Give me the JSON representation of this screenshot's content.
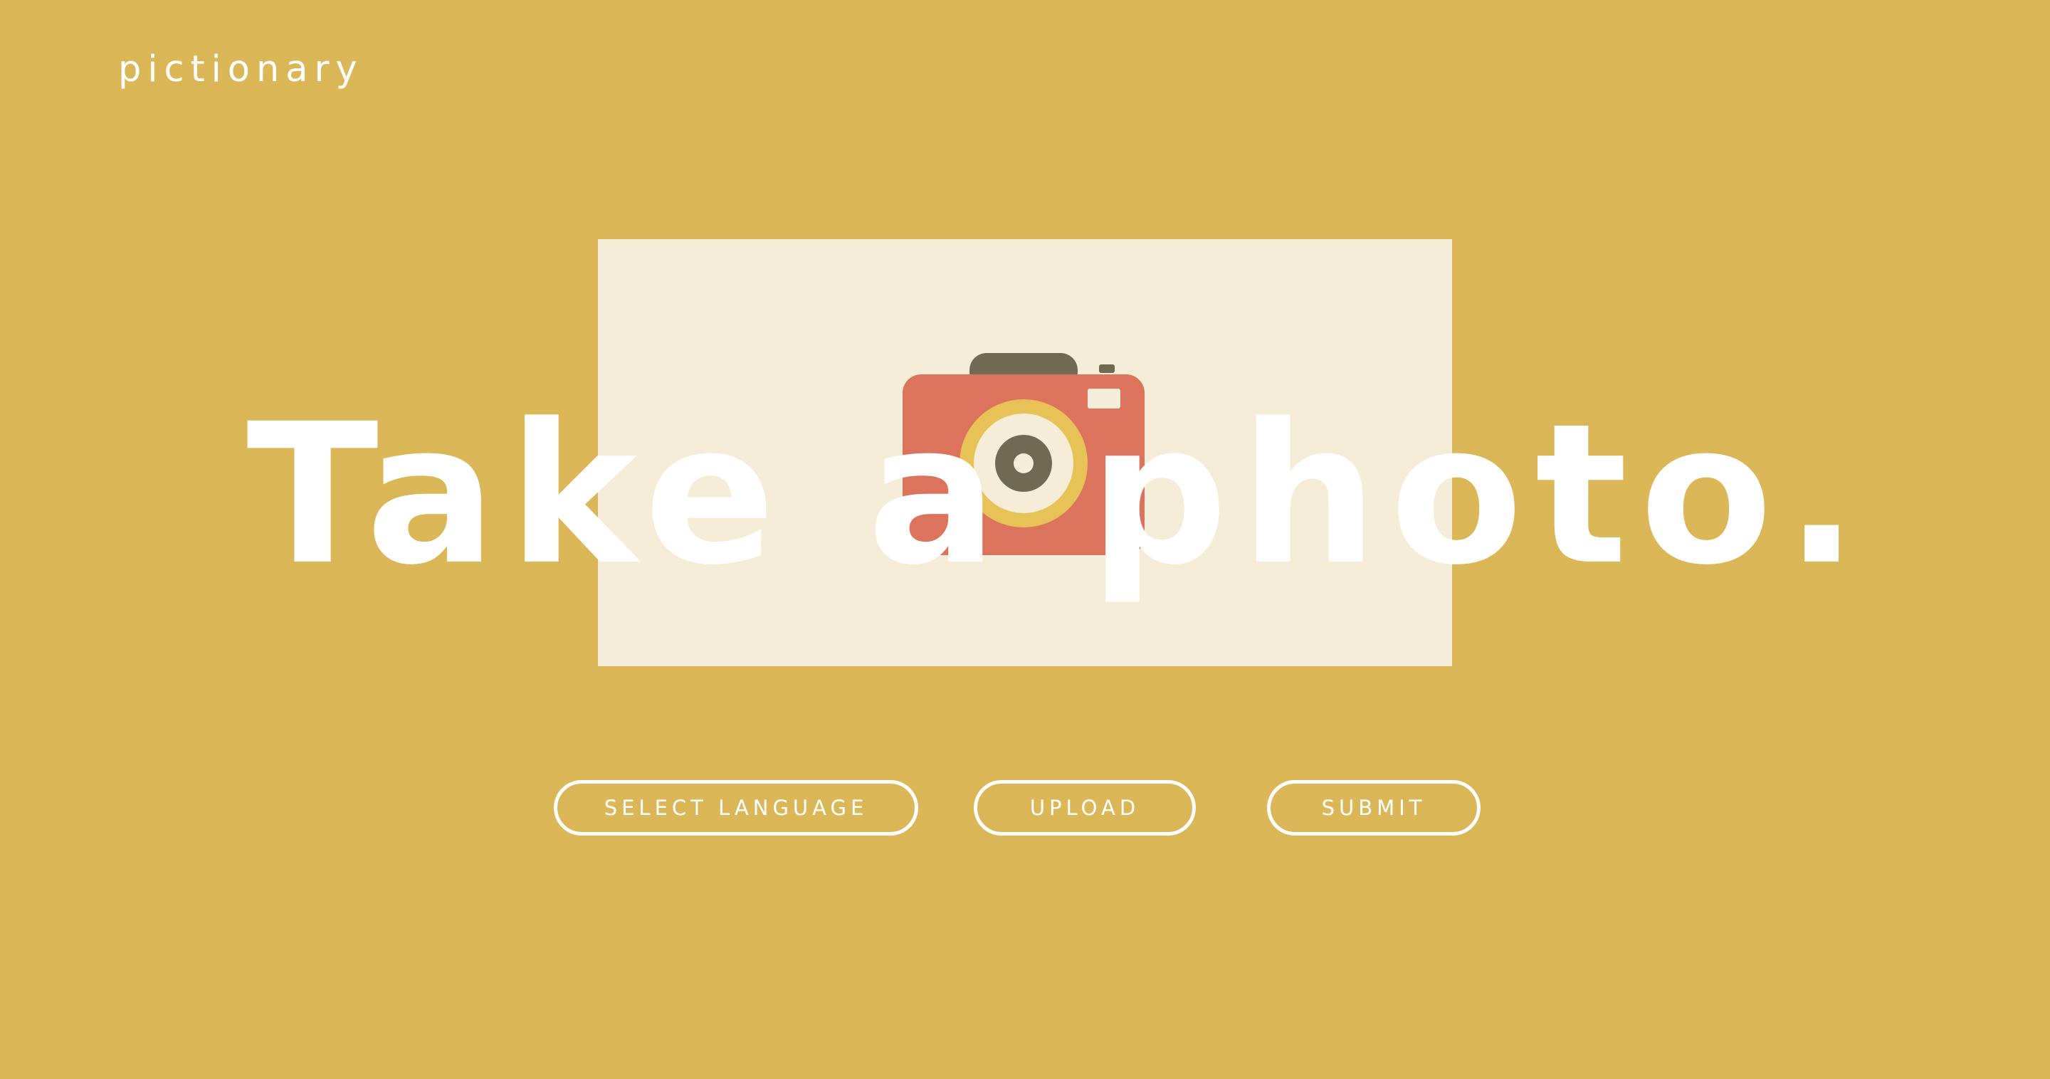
{
  "header": {
    "logo_text": "pictionary"
  },
  "hero": {
    "headline": "Take a photo.",
    "photo_placeholder_icon": "camera-icon"
  },
  "actions": {
    "select_language_label": "SELECT LANGUAGE",
    "upload_label": "UPLOAD",
    "submit_label": "SUBMIT"
  },
  "colors": {
    "background": "#dbb757",
    "frame": "#f5edd7",
    "camera_body": "#dc735c",
    "camera_top": "#6f6a52",
    "lens_ring": "#e6c257",
    "lens_inner": "#f5edd7",
    "text": "#ffffff"
  }
}
